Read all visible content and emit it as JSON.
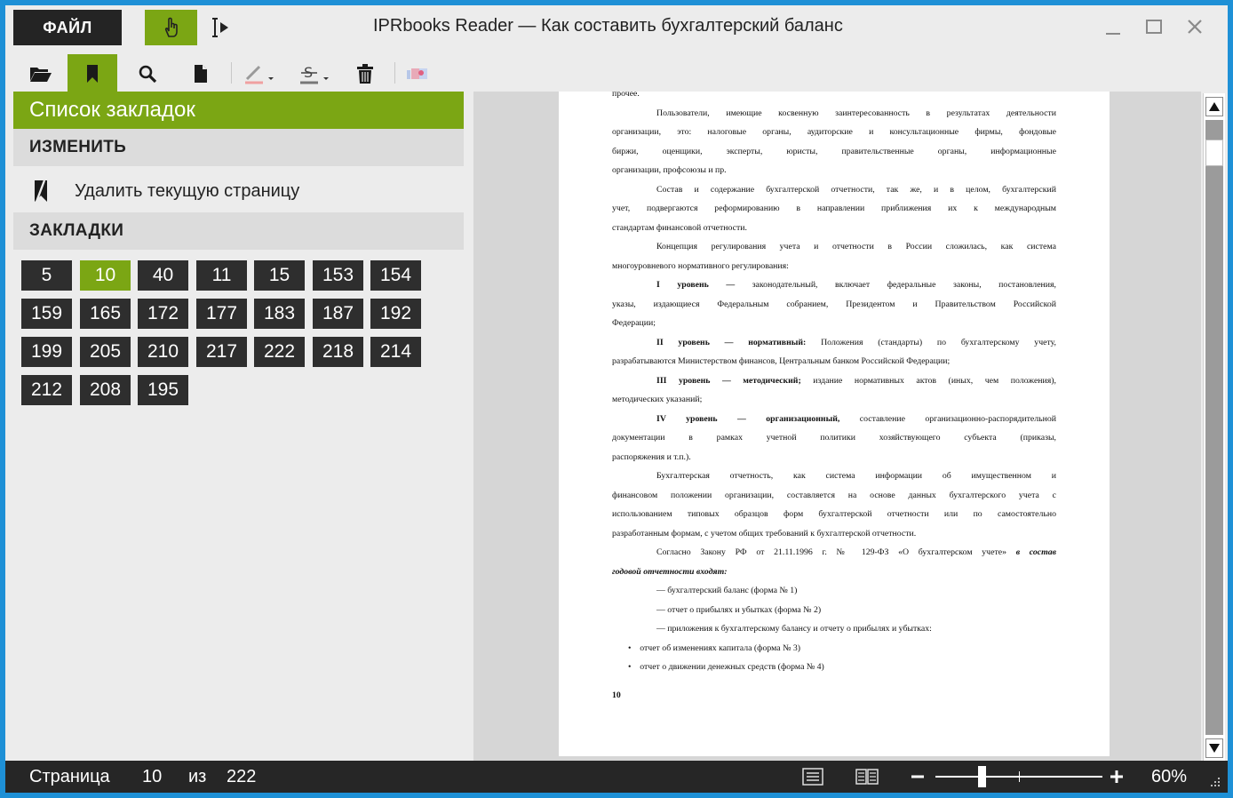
{
  "window": {
    "title": "IPRbooks Reader — Как составить бухгалтерский баланс",
    "file_label": "ФАЙЛ"
  },
  "sidebar": {
    "header": "Список закладок",
    "edit_section": "ИЗМЕНИТЬ",
    "delete_action": "Удалить текущую страницу",
    "bookmarks_section": "ЗАКЛАДКИ",
    "bookmarks": [
      "5",
      "10",
      "40",
      "11",
      "15",
      "153",
      "154",
      "159",
      "165",
      "172",
      "177",
      "183",
      "187",
      "192",
      "199",
      "205",
      "210",
      "217",
      "222",
      "218",
      "214",
      "212",
      "208",
      "195"
    ],
    "current_bookmark": "10"
  },
  "page": {
    "lines": [
      "прочее.",
      "Пользователи, имеющие косвенную заинтересованность в результатах деятельности",
      "организации, это: налоговые органы, аудиторские и консультационные фирмы, фондовые",
      "биржи, оценщики, эксперты, юристы, правительственные органы, информационные",
      "организации, профсоюзы и пр.",
      "Состав и содержание бухгалтерской отчетности, так же, и в целом, бухгалтерский",
      "учет, подвергаются реформированию в направлении приближения их к международным",
      "стандартам финансовой отчетности.",
      "Концепция регулирования учета и отчетности в России сложилась, как система",
      "многоуровневого нормативного регулирования:",
      "законодательный, включает федеральные законы, постановления,",
      "указы, издающиеся Федеральным собранием, Президентом и Правительством Российской",
      "Федерации;",
      "Положения (стандарты) по бухгалтерскому учету,",
      "разрабатываются Министерством финансов, Центральным банком Российской Федерации;",
      "издание нормативных актов (иных, чем положения),",
      "методических указаний;",
      "составление организационно-распорядительной",
      "документации в рамках учетной политики хозяйствующего субъекта (приказы,",
      "распоряжения и т.п.).",
      "Бухгалтерская отчетность, как система информации об имущественном и",
      "финансовом положении организации, составляется на основе данных бухгалтерского учета с",
      "использованием типовых образцов форм бухгалтерской отчетности или по самостоятельно",
      "разработанным формам, с учетом общих требований к бухгалтерской отчетности.",
      "Согласно Закону РФ от 21.11.1996 г. № 129-ФЗ «О бухгалтерском учете»",
      "годовой отчетности входят:",
      "— бухгалтерский баланс (форма № 1)",
      "— отчет о прибылях и убытках (форма № 2)",
      "— приложения к бухгалтерскому балансу и отчету о прибылях и убытках:",
      "отчет об изменениях капитала (форма № 3)",
      "отчет о движении денежных средств (форма № 4)"
    ],
    "level_1": "I уровень — ",
    "level_2": "II уровень — нормативный:",
    "level_3": "III уровень — методический;",
    "level_4": "IV уровень — организационный,",
    "italic_tail": "в состав",
    "page_number": "10"
  },
  "status": {
    "page_label": "Страница",
    "current_page": "10",
    "of_label": "из",
    "total_pages": "222",
    "zoom": "60%"
  },
  "colors": {
    "accent": "#7ba614",
    "dark": "#262626",
    "frame": "#1e90d6"
  }
}
